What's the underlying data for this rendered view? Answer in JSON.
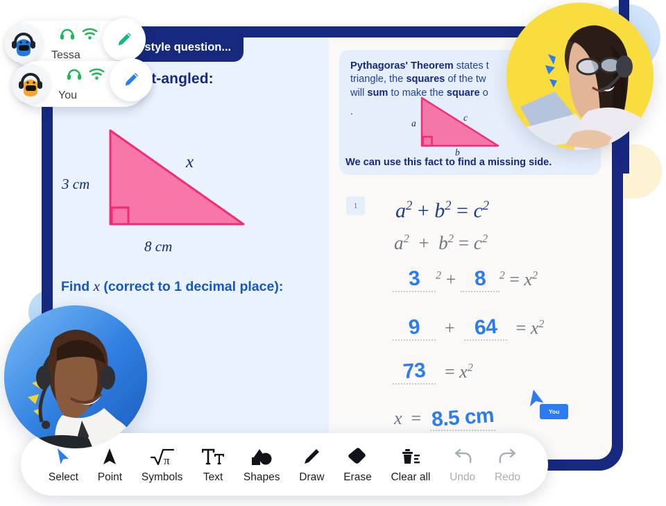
{
  "window": {
    "tab_title": "am style question..."
  },
  "presence": [
    {
      "name": "Tessa",
      "avatar_color": "#1f7ae0",
      "pen_color": "#10b981",
      "mic_icon": "headphones-icon",
      "net_icon": "wifi-icon",
      "tool_icon": "pencil-icon"
    },
    {
      "name": "You",
      "avatar_color": "#f5a623",
      "pen_color": "#2b7cf0",
      "mic_icon": "headphones-icon",
      "net_icon": "wifi-icon",
      "tool_icon": "pencil-icon"
    }
  ],
  "question": {
    "title": "BC is right-angled:",
    "find_prefix": "Find",
    "find_variable": "x",
    "find_suffix": "(correct to 1 decimal place):",
    "diagram": {
      "side_vertical": "3 cm",
      "side_horizontal": "8 cm",
      "hypotenuse": "x",
      "right_angle_marker": true,
      "fill_color": "#f8558f"
    }
  },
  "theorem": {
    "line1_bold": "Pythagoras' Theorem",
    "line1_rest": " states t",
    "line2a": "triangle, the ",
    "line2b": "squares",
    "line2c": " of the tw",
    "line3a": "will ",
    "line3b": "sum",
    "line3c": " to make the ",
    "line3d": "square",
    "line3e": " o",
    "line4": ".",
    "footer": "We can use this fact to find a missing side.",
    "labels": {
      "a": "a",
      "b": "b",
      "c": "c"
    }
  },
  "working": {
    "step_number": "1",
    "row1": {
      "a": "a",
      "b": "b",
      "c": "c",
      "exp": "2",
      "plus": "+",
      "eq": "="
    },
    "row2": {
      "a": "a",
      "b": "b",
      "c": "c",
      "exp": "2",
      "plus": "+",
      "eq": "="
    },
    "row3": {
      "handwritten_1": "3",
      "exp_1": "2",
      "plus": "+",
      "handwritten_2": "8",
      "exp_2": "2",
      "eq": "=",
      "rhs": "x",
      "rhs_exp": "2"
    },
    "row4": {
      "handwritten_1": "9",
      "plus": "+",
      "handwritten_2": "64",
      "eq": "=",
      "rhs": "x",
      "rhs_exp": "2"
    },
    "row5": {
      "handwritten_1": "73",
      "eq": "=",
      "rhs": "x",
      "rhs_exp": "2"
    },
    "row6": {
      "lhs": "x",
      "eq": "=",
      "answer": "8.5 cm"
    }
  },
  "cursor": {
    "label": "You",
    "color": "#2b7cf0"
  },
  "toolbar": [
    {
      "label": "Select",
      "icon": "cursor-arrow-icon",
      "active": true,
      "enabled": true
    },
    {
      "label": "Point",
      "icon": "pointer-triangle-icon",
      "active": false,
      "enabled": true
    },
    {
      "label": "Symbols",
      "icon": "sqrt-pi-icon",
      "active": false,
      "enabled": true
    },
    {
      "label": "Text",
      "icon": "text-icon",
      "active": false,
      "enabled": true
    },
    {
      "label": "Shapes",
      "icon": "shapes-icon",
      "active": false,
      "enabled": true
    },
    {
      "label": "Draw",
      "icon": "pencil-icon",
      "active": false,
      "enabled": true
    },
    {
      "label": "Erase",
      "icon": "eraser-icon",
      "active": false,
      "enabled": true
    },
    {
      "label": "Clear all",
      "icon": "trash-icon",
      "active": false,
      "enabled": true
    },
    {
      "label": "Undo",
      "icon": "undo-arrow-icon",
      "active": false,
      "enabled": false
    },
    {
      "label": "Redo",
      "icon": "redo-arrow-icon",
      "active": false,
      "enabled": false
    }
  ],
  "colors": {
    "navy": "#16297e",
    "board_left": "#eaf2fd",
    "board_right": "#faf9f8",
    "pink": "#f8558f",
    "accent_blue": "#2b7cf0",
    "yellow": "#f9dc3e"
  }
}
